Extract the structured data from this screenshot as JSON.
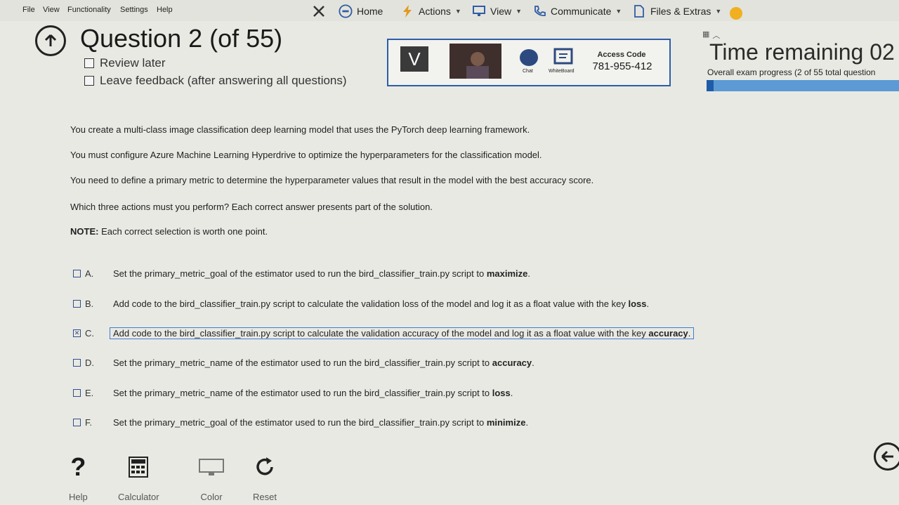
{
  "menu": [
    "File",
    "View",
    "Functionality",
    "Settings",
    "Help"
  ],
  "toolbar": {
    "home": "Home",
    "actions": "Actions",
    "view": "View",
    "communicate": "Communicate",
    "files": "Files & Extras"
  },
  "header": {
    "title": "Question 2 (of 55)",
    "review_later": "Review later",
    "leave_feedback": "Leave feedback (after answering all questions)"
  },
  "proctor": {
    "v_label": "V",
    "chat": "Chat",
    "whiteboard": "WhiteBoard",
    "access_label": "Access Code",
    "access_code": "781-955-412"
  },
  "timer": {
    "label": "Time remaining 02",
    "progress_text": "Overall exam progress (2 of 55 total question",
    "progress_fraction": 0.036
  },
  "question": {
    "p1": "You create a multi-class image classification deep learning model that uses the PyTorch deep learning framework.",
    "p2": "You must configure Azure Machine Learning Hyperdrive to optimize the hyperparameters for the classification model.",
    "p3": "You need to define a primary metric to determine the hyperparameter values that result in the model with the best accuracy score.",
    "p4": "Which three actions must you perform? Each correct answer presents part of the solution.",
    "note_label": "NOTE:",
    "note_text": " Each correct selection is worth one point."
  },
  "options": [
    {
      "letter": "A.",
      "text": "Set the primary_metric_goal of the estimator used to run the bird_classifier_train.py script to ",
      "bold": "maximize",
      "end": ".",
      "checked": false
    },
    {
      "letter": "B.",
      "text": "Add code to the bird_classifier_train.py script to calculate the validation loss of the model and log it as a float value with the key ",
      "bold": "loss",
      "end": ".",
      "checked": false
    },
    {
      "letter": "C.",
      "text": "Add code to the bird_classifier_train.py script to calculate the validation accuracy of the model and log it as a float value with the key ",
      "bold": "accuracy",
      "end": ".",
      "checked": true
    },
    {
      "letter": "D.",
      "text": "Set the primary_metric_name of the estimator used to run the bird_classifier_train.py script to ",
      "bold": "accuracy",
      "end": ".",
      "checked": false
    },
    {
      "letter": "E.",
      "text": "Set the primary_metric_name of the estimator used to run the bird_classifier_train.py script to ",
      "bold": "loss",
      "end": ".",
      "checked": false
    },
    {
      "letter": "F.",
      "text": "Set the primary_metric_goal of the estimator used to run the bird_classifier_train.py script to ",
      "bold": "minimize",
      "end": ".",
      "checked": false
    }
  ],
  "tools": {
    "help": "Help",
    "calculator": "Calculator",
    "color": "Color",
    "reset": "Reset"
  },
  "colors": {
    "accent": "#2c5ea8",
    "progress": "#5b9ad4"
  }
}
